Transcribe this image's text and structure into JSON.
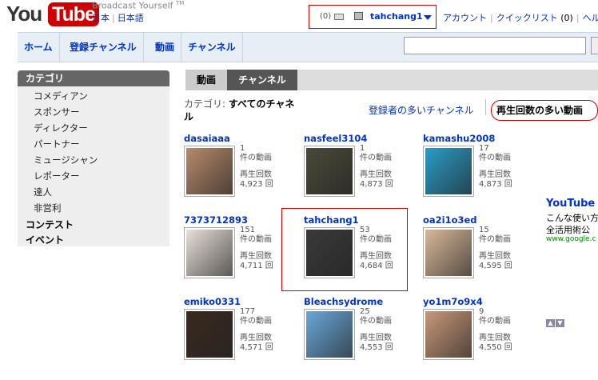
{
  "header": {
    "logo_you": "You",
    "logo_tube": "Tube",
    "tagline": "Broadcast Yourself",
    "tm": "TM",
    "lang_country": "日本",
    "lang_language": "日本語",
    "mail_count": "(0)",
    "username": "tahchang1",
    "account_link": "アカウント",
    "quicklist_link": "クイックリスト",
    "quicklist_count": "(0)",
    "help_link": "ヘルプ"
  },
  "nav": {
    "tabs": [
      "ホーム",
      "登録チャンネル",
      "動画",
      "チャンネル"
    ]
  },
  "sidebar": {
    "category_header": "カテゴリ",
    "items": [
      "コメディアン",
      "スポンサー",
      "ディレクター",
      "パートナー",
      "ミュージシャン",
      "レポーター",
      "達人",
      "非営利"
    ],
    "contests": "コンテスト",
    "events": "イベント"
  },
  "content_tabs": {
    "videos": "動画",
    "channels": "チャンネル"
  },
  "category_label": {
    "prefix": "カテゴリ: ",
    "value": "すべてのチャネル"
  },
  "sort": {
    "most_subscribed": "登録者の多いチャンネル",
    "most_viewed": "再生回数の多い動画"
  },
  "channels": [
    {
      "name": "dasaiaaa",
      "videos": "1",
      "videos_label": "件の動画",
      "views_label": "再生回数",
      "views": "4,923 回",
      "thumb_color": "#b88a6a"
    },
    {
      "name": "nasfeel3104",
      "videos": "1",
      "videos_label": "件の動画",
      "views_label": "再生回数",
      "views": "4,873 回",
      "thumb_color": "#4a4a3a"
    },
    {
      "name": "kamashu2008",
      "videos": "17",
      "videos_label": "件の動画",
      "views_label": "再生回数",
      "views": "4,873 回",
      "thumb_color": "#2a9cc8"
    },
    {
      "name": "7373712893",
      "videos": "151",
      "videos_label": "件の動画",
      "views_label": "再生回数",
      "views": "4,711 回",
      "thumb_color": "#e8e0d8"
    },
    {
      "name": "tahchang1",
      "videos": "53",
      "videos_label": "件の動画",
      "views_label": "再生回数",
      "views": "4,684 回",
      "thumb_color": "#3a3a3a"
    },
    {
      "name": "oa2i1o3ed",
      "videos": "15",
      "videos_label": "件の動画",
      "views_label": "再生回数",
      "views": "4,595 回",
      "thumb_color": "#d8b898"
    },
    {
      "name": "emiko0331",
      "videos": "177",
      "videos_label": "件の動画",
      "views_label": "再生回数",
      "views": "4,571 回",
      "thumb_color": "#3a2a20"
    },
    {
      "name": "Bleachsydrome",
      "videos": "25",
      "videos_label": "件の動画",
      "views_label": "再生回数",
      "views": "4,553 回",
      "thumb_color": "#6aa8d8"
    },
    {
      "name": "yo1m7o9x4",
      "videos": "9",
      "videos_label": "件の動画",
      "views_label": "再生回数",
      "views": "4,550 回",
      "thumb_color": "#c89878"
    }
  ],
  "ad": {
    "title": "YouTube",
    "line1": "こんな使い方",
    "line2": "全活用術公",
    "url": "www.google.c",
    "arrows": "AV"
  }
}
